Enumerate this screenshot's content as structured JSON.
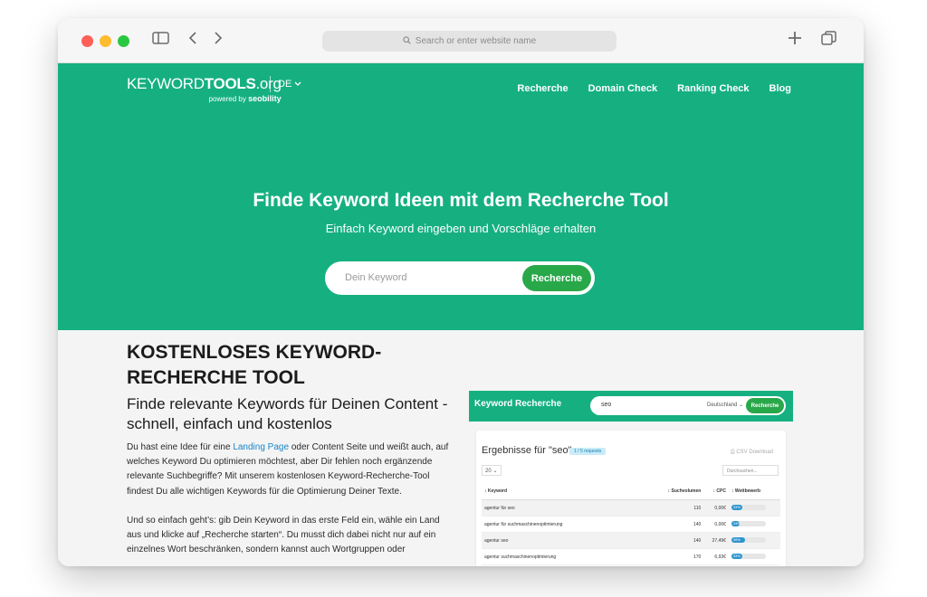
{
  "browser": {
    "address_placeholder": "Search or enter website name",
    "icons": [
      "sidebar-icon",
      "back-icon",
      "forward-icon",
      "search-icon",
      "new-tab-icon",
      "tabs-overview-icon"
    ]
  },
  "logo": {
    "keyword": "KEYWORD",
    "tools": "TOOLS",
    "org": ".org",
    "powered_by": "powered by",
    "brand": "seobility"
  },
  "lang": {
    "label": "DE"
  },
  "nav": {
    "items": [
      "Recherche",
      "Domain Check",
      "Ranking Check",
      "Blog"
    ]
  },
  "hero": {
    "title": "Finde Keyword Ideen mit dem Recherche Tool",
    "subtitle": "Einfach Keyword eingeben und Vorschläge erhalten",
    "search_placeholder": "Dein Keyword",
    "search_button": "Recherche"
  },
  "content": {
    "h1": "KOSTENLOSES KEYWORD-RECHERCHE TOOL",
    "h2": "Finde relevante Keywords für Deinen Content - schnell, einfach und kostenlos",
    "p1_before": "Du hast eine Idee für eine ",
    "p1_link": "Landing Page",
    "p1_after": " oder Content Seite und weißt auch, auf welches Keyword Du optimieren möchtest, aber Dir fehlen noch ergänzende relevante Suchbegriffe? Mit unserem kostenlosen Keyword-Recherche-Tool findest Du alle wichtigen Keywords für die Optimierung Deiner Texte.",
    "p2": "Und so einfach geht’s: gib Dein Keyword in das erste Feld ein, wähle ein Land aus und klicke auf „Recherche starten“. Du musst dich dabei nicht nur auf ein einzelnes Wort beschränken, sondern kannst auch Wortgruppen oder"
  },
  "mock": {
    "title": "Keyword Recherche",
    "keyword": "seo",
    "country": "Deutschland",
    "button": "Recherche",
    "results_title": "Ergebnisse für \"seo\"",
    "badge": "1 / 5 requests",
    "csv": "CSV Download",
    "per_page": "20",
    "filter_placeholder": "Durchsuchen...",
    "columns": [
      "Keyword",
      "Suchvolumen",
      "CPC",
      "Wettbewerb"
    ],
    "rows": [
      {
        "keyword": "agentur für seo",
        "volume": "110",
        "cpc": "0,00€",
        "competition": 0.33,
        "competition_label": "33%"
      },
      {
        "keyword": "agentur für suchmaschinenoptimierung",
        "volume": "140",
        "cpc": "0,00€",
        "competition": 0.24,
        "competition_label": "24%"
      },
      {
        "keyword": "agentur seo",
        "volume": "140",
        "cpc": "27,49€",
        "competition": 0.39,
        "competition_label": "39%"
      },
      {
        "keyword": "agentur suchmaschinenoptimierung",
        "volume": "170",
        "cpc": "6,93€",
        "competition": 0.33,
        "competition_label": "33%"
      }
    ]
  },
  "colors": {
    "brand_green": "#16b080",
    "button_green": "#29a84a",
    "link_blue": "#1a85c8",
    "bar_blue": "#2d95cf"
  }
}
